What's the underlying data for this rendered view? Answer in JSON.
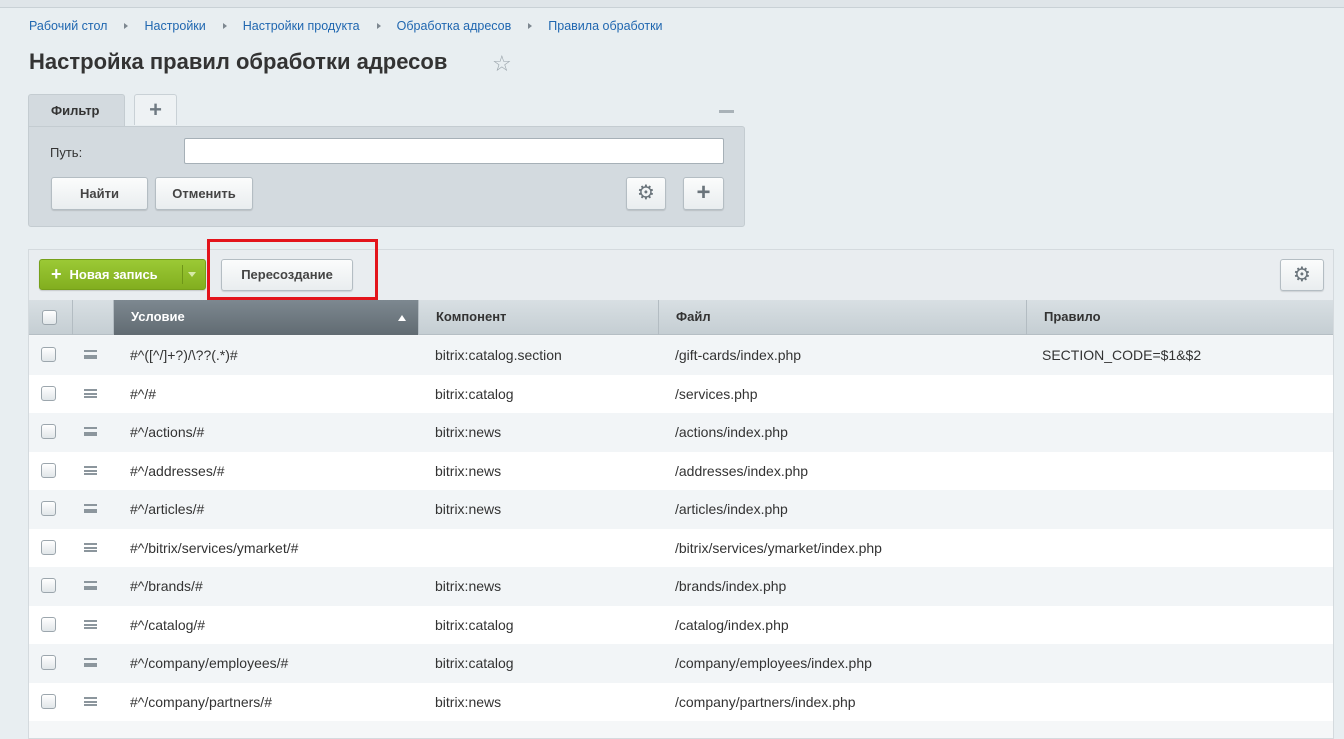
{
  "breadcrumb": [
    "Рабочий стол",
    "Настройки",
    "Настройки продукта",
    "Обработка адресов",
    "Правила обработки"
  ],
  "page_title": "Настройка правил обработки адресов",
  "filter": {
    "tab_label": "Фильтр",
    "path_label": "Путь:",
    "path_value": "",
    "find_button": "Найти",
    "cancel_button": "Отменить"
  },
  "toolbar": {
    "new_record_button": "Новая запись",
    "recreate_button": "Пересоздание"
  },
  "table": {
    "columns": [
      "Условие",
      "Компонент",
      "Файл",
      "Правило"
    ],
    "sorted_column": "Условие",
    "sort_direction": "asc",
    "rows": [
      {
        "condition": "#^([^/]+?)/\\??(.*)#",
        "component": "bitrix:catalog.section",
        "file": "/gift-cards/index.php",
        "rule": "SECTION_CODE=$1&$2"
      },
      {
        "condition": "#^/#",
        "component": "bitrix:catalog",
        "file": "/services.php",
        "rule": ""
      },
      {
        "condition": "#^/actions/#",
        "component": "bitrix:news",
        "file": "/actions/index.php",
        "rule": ""
      },
      {
        "condition": "#^/addresses/#",
        "component": "bitrix:news",
        "file": "/addresses/index.php",
        "rule": ""
      },
      {
        "condition": "#^/articles/#",
        "component": "bitrix:news",
        "file": "/articles/index.php",
        "rule": ""
      },
      {
        "condition": "#^/bitrix/services/ymarket/#",
        "component": "",
        "file": "/bitrix/services/ymarket/index.php",
        "rule": ""
      },
      {
        "condition": "#^/brands/#",
        "component": "bitrix:news",
        "file": "/brands/index.php",
        "rule": ""
      },
      {
        "condition": "#^/catalog/#",
        "component": "bitrix:catalog",
        "file": "/catalog/index.php",
        "rule": ""
      },
      {
        "condition": "#^/company/employees/#",
        "component": "bitrix:catalog",
        "file": "/company/employees/index.php",
        "rule": ""
      },
      {
        "condition": "#^/company/partners/#",
        "component": "bitrix:news",
        "file": "/company/partners/index.php",
        "rule": ""
      }
    ]
  },
  "colors": {
    "link": "#2067b0",
    "accent_green": "#8cb828",
    "highlight_red": "#e3141b",
    "header_sorted": "#6c767d"
  },
  "icons": [
    "star-icon",
    "plus-icon",
    "minimize-icon",
    "gear-icon",
    "drag-handle-icon",
    "sort-asc-icon",
    "dropdown-arrow-icon"
  ]
}
